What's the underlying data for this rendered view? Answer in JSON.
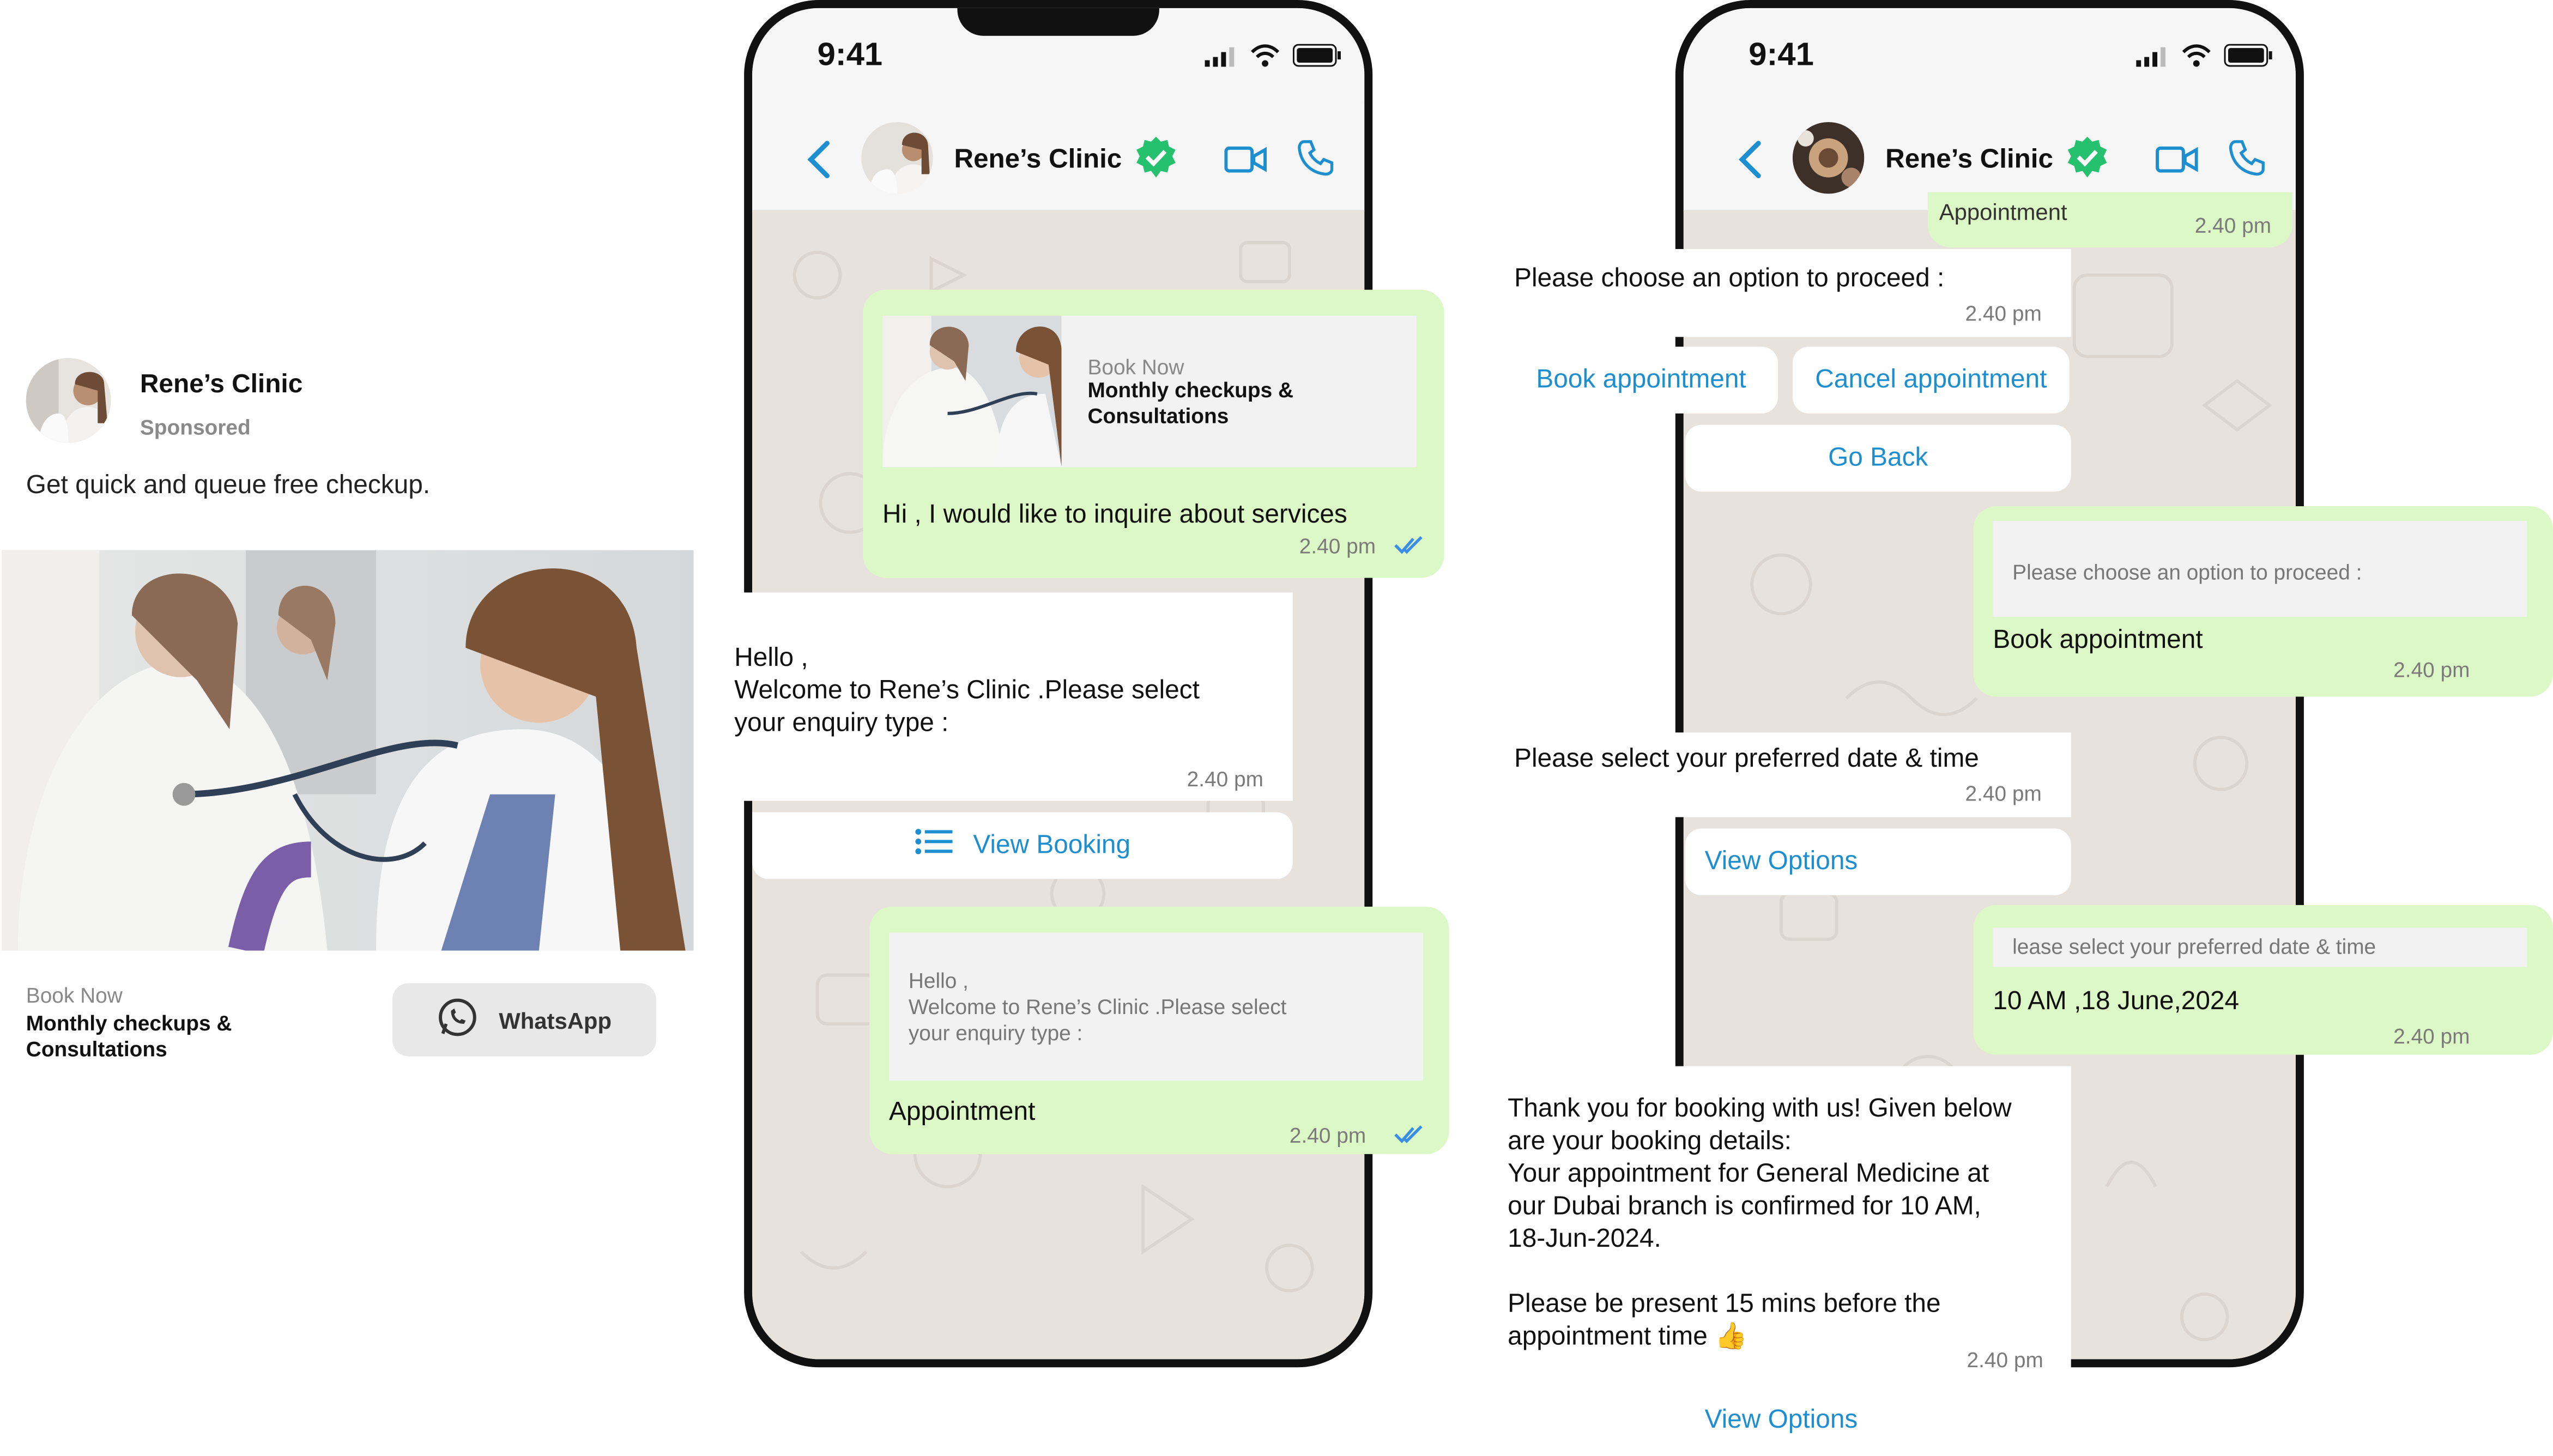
{
  "ad": {
    "name": "Rene’s Clinic",
    "sponsored": "Sponsored",
    "text": "Get quick and queue free checkup.",
    "book_now": "Book Now",
    "title": "Monthly checkups & Consultations",
    "whatsapp_label": "WhatsApp"
  },
  "phone1": {
    "time": "9:41",
    "contact": "Rene’s Clinic",
    "msg1": {
      "card_kicker": "Book Now",
      "card_title": "Monthly checkups & Consultations",
      "text": "Hi , I would like to inquire about services",
      "time": "2.40 pm"
    },
    "msg2": {
      "line1": "Hello ,",
      "line2": "Welcome to Rene’s Clinic .Please select",
      "line3": "your enquiry type :",
      "time": "2.40 pm",
      "button": "View Booking"
    },
    "msg3": {
      "quote1": "Hello ,",
      "quote2": "Welcome to Rene’s Clinic .Please select",
      "quote3": "your enquiry type :",
      "text": "Appointment",
      "time": "2.40 pm"
    }
  },
  "phone2": {
    "time": "9:41",
    "contact": "Rene’s Clinic",
    "top_cut_text": "Appointment",
    "top_cut_time": "2.40 pm",
    "msg1": {
      "text": "Please choose an option to proceed :",
      "time": "2.40 pm",
      "btn_book": "Book appointment",
      "btn_cancel": "Cancel appointment",
      "btn_back": "Go Back"
    },
    "msg2": {
      "quote": "Please choose an option to proceed :",
      "text": "Book appointment",
      "time": "2.40 pm"
    },
    "msg3": {
      "text": "Please select your preferred date & time",
      "time": "2.40 pm",
      "button": "View Options"
    },
    "msg4": {
      "quote": "lease select your preferred date & time",
      "text": "10 AM ,18 June,2024",
      "time": "2.40 pm"
    },
    "msg5": {
      "line1": "Thank you for booking with us! Given below",
      "line2": "are your booking details:",
      "line3": "Your appointment for General Medicine at",
      "line4": "our Dubai branch is confirmed for 10 AM,",
      "line5": "18-Jun-2024.",
      "line6": "Please be present 15 mins before the",
      "line7": "appointment time 👍",
      "time": "2.40 pm",
      "button": "View Options"
    }
  },
  "colors": {
    "green_bubble": "#dcf8c6",
    "link_blue": "#1d8fd1",
    "verified_green": "#25c16f",
    "wallpaper": "#e8e2dc"
  },
  "icons": [
    "back-chevron-icon",
    "verified-badge-icon",
    "video-call-icon",
    "phone-call-icon",
    "signal-icon",
    "wifi-icon",
    "battery-icon",
    "double-check-icon",
    "list-icon",
    "whatsapp-icon"
  ]
}
